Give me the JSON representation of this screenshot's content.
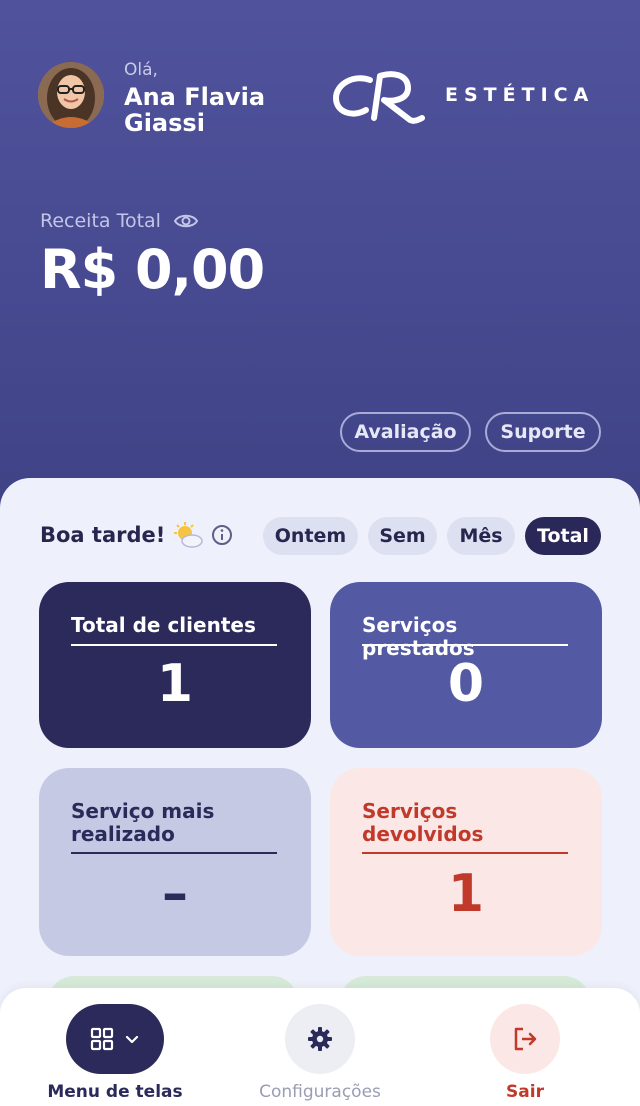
{
  "header": {
    "greeting": "Olá,",
    "user_name": "Ana Flavia Giassi",
    "brand": "ESTÉTICA",
    "revenue_label": "Receita Total",
    "revenue_value": "R$ 0,00",
    "eye_icon": "eye-icon",
    "buttons": {
      "evaluation": "Avaliação",
      "support": "Suporte"
    }
  },
  "dashboard": {
    "greeting": "Boa tarde!",
    "weather_icon": "partly-sunny-icon",
    "info_icon": "info-icon",
    "filters": [
      "Ontem",
      "Sem",
      "Mês",
      "Total"
    ],
    "active_filter": "Total",
    "cards": [
      {
        "title": "Total de clientes",
        "value": "1",
        "bg": "#2b2a5a",
        "fg": "#ffffff"
      },
      {
        "title": "Serviços prestados",
        "value": "0",
        "bg": "#5359a3",
        "fg": "#ffffff"
      },
      {
        "title": "Serviço mais realizado",
        "value": "–",
        "bg": "#c6c9e4",
        "fg": "#2b2a5a"
      },
      {
        "title": "Serviços devolvidos",
        "value": "1",
        "bg": "#fbe8e6",
        "fg": "#c0392b"
      }
    ]
  },
  "nav": {
    "menu": "Menu de telas",
    "settings": "Configurações",
    "exit": "Sair",
    "icons": [
      "grid-icon",
      "gear-icon",
      "logout-icon"
    ]
  },
  "colors": {
    "primary_dark": "#2b2a5a",
    "primary": "#50539c",
    "danger": "#c0392b"
  }
}
